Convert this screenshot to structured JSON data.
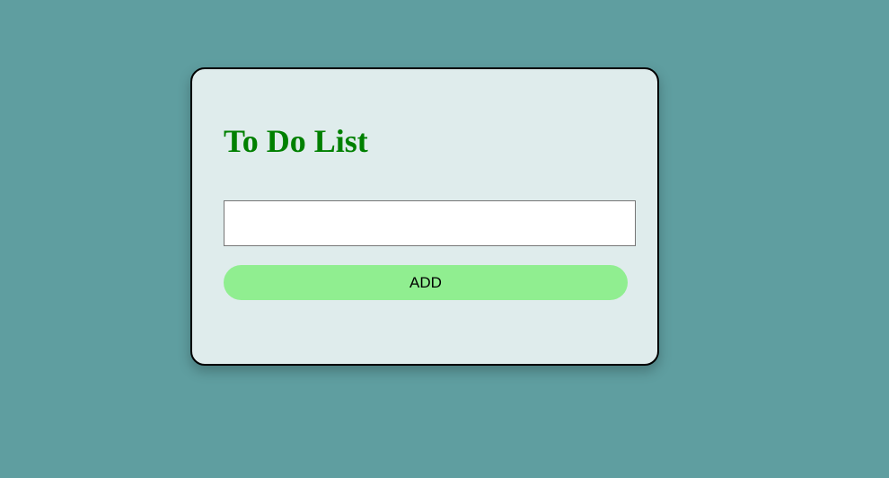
{
  "todo": {
    "title": "To Do List",
    "input": {
      "value": "",
      "placeholder": ""
    },
    "add_label": "ADD"
  },
  "colors": {
    "page_background": "#5f9ea0",
    "card_background": "#dfecec",
    "title_color": "#008000",
    "button_background": "#90ee90"
  }
}
